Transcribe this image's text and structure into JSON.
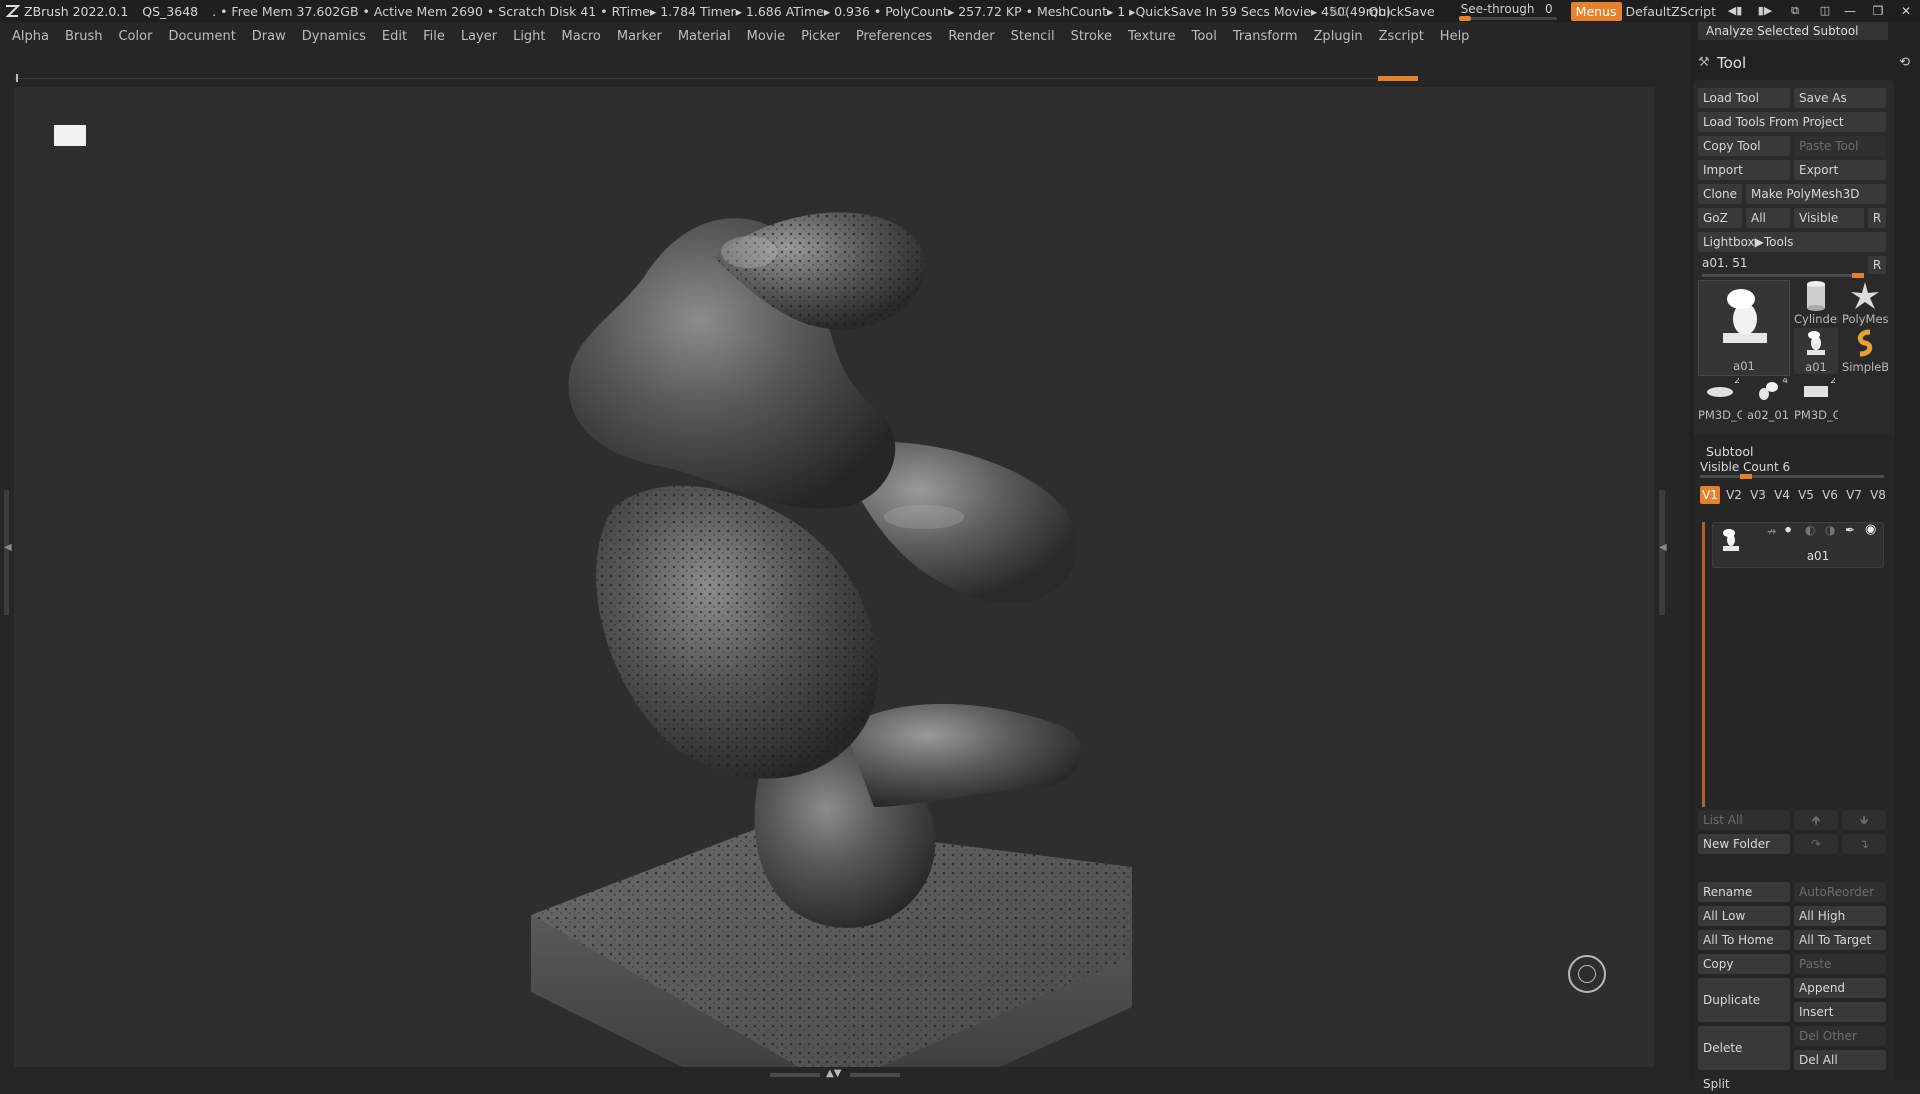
{
  "titlebar": {
    "app": "ZBrush 2022.0.1",
    "project": "QS_3648",
    "stats": ". • Free Mem 37.602GB • Active Mem 2690 • Scratch Disk 41 •  RTime▸ 1.784 Timer▸ 1.686 ATime▸ 0.936 • PolyCount▸ 257.72 KP  • MeshCount▸ 1  ▸QuickSave In 59 Secs Movie▸ 450(49mb)",
    "ac": "AC",
    "quicksave": "QuickSave",
    "seethrough_label": "See-through",
    "seethrough_value": "0",
    "seethrough_level": 0,
    "menus": "Menus",
    "script": "DefaultZScript"
  },
  "menubar": {
    "items": [
      "Alpha",
      "Brush",
      "Color",
      "Document",
      "Draw",
      "Dynamics",
      "Edit",
      "File",
      "Layer",
      "Light",
      "Macro",
      "Marker",
      "Material",
      "Movie",
      "Picker",
      "Preferences",
      "Render",
      "Stencil",
      "Stroke",
      "Texture",
      "Tool",
      "Transform",
      "Zplugin",
      "Zscript",
      "Help"
    ]
  },
  "panel": {
    "analyze": "Analyze Selected Subtool",
    "tool_title": "Tool",
    "buttons": {
      "load_tool": "Load Tool",
      "save_as": "Save As",
      "load_from_project": "Load Tools From Project",
      "copy_tool": "Copy Tool",
      "paste_tool": "Paste Tool",
      "import": "Import",
      "export": "Export",
      "clone": "Clone",
      "make_polymesh": "Make PolyMesh3D",
      "goz": "GoZ",
      "all": "All",
      "visible": "Visible",
      "r": "R",
      "lightbox": "Lightbox▶Tools"
    },
    "tool_slider": {
      "label": "a01. 51",
      "r": "R"
    },
    "thumbnails": [
      {
        "label": "a01",
        "badge": ""
      },
      {
        "label": "Cylinder",
        "badge": ""
      },
      {
        "label": "PolyMes",
        "badge": ""
      },
      {
        "label": "a01",
        "badge": ""
      },
      {
        "label": "SimpleB",
        "badge": ""
      },
      {
        "label": "PM3D_C",
        "badge": "2"
      },
      {
        "label": "a02_01",
        "badge": "4"
      },
      {
        "label": "PM3D_C",
        "badge": "2"
      }
    ],
    "subtool": {
      "title": "Subtool",
      "visible_count": "Visible Count 6",
      "tabs": [
        "V1",
        "V2",
        "V3",
        "V4",
        "V5",
        "V6",
        "V7",
        "V8"
      ],
      "active_tab": "V1",
      "item_name": "a01",
      "list_all": "List All",
      "new_folder": "New Folder",
      "rename": "Rename",
      "autoreorder": "AutoReorder",
      "all_low": "All Low",
      "all_high": "All High",
      "all_to_home": "All To Home",
      "all_to_target": "All To Target",
      "copy": "Copy",
      "paste": "Paste",
      "duplicate": "Duplicate",
      "append": "Append",
      "insert": "Insert",
      "delete": "Delete",
      "del_other": "Del Other",
      "del_all": "Del All",
      "split": "Split"
    }
  }
}
